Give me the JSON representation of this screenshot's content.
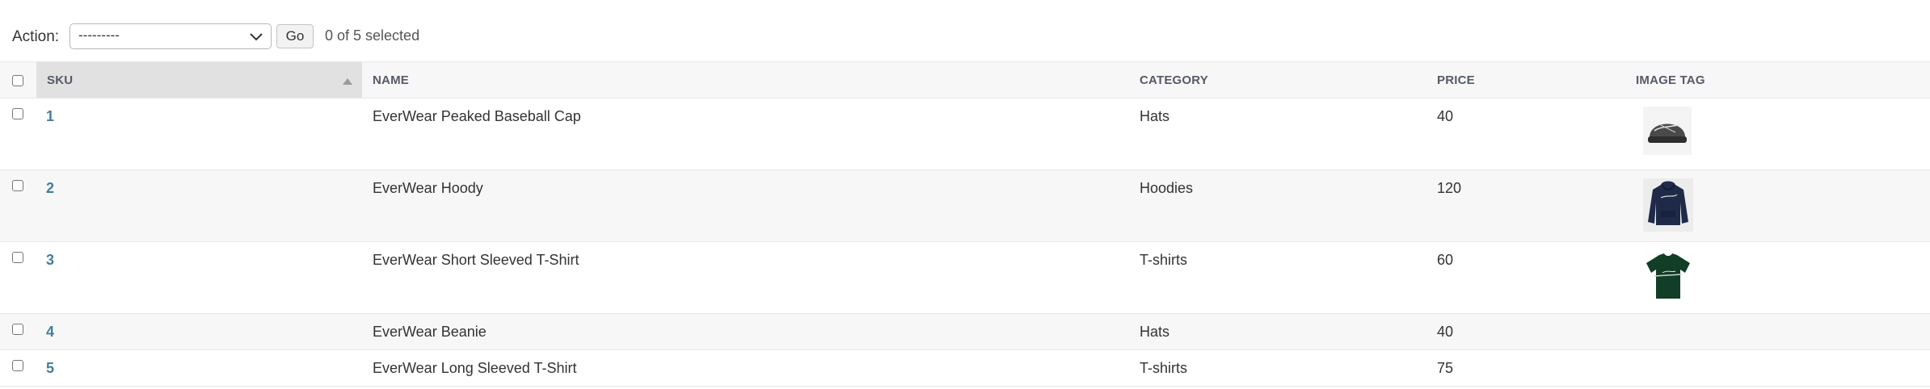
{
  "actions": {
    "label": "Action:",
    "select_value": "---------",
    "go_label": "Go",
    "selection_counter": "0 of 5 selected"
  },
  "table": {
    "headers": {
      "sku": "SKU",
      "name": "NAME",
      "category": "CATEGORY",
      "price": "PRICE",
      "image_tag": "IMAGE TAG"
    },
    "sorted_column": "sku",
    "sort_direction": "ascending",
    "rows": [
      {
        "sku": "1",
        "name": "EverWear Peaked Baseball Cap",
        "category": "Hats",
        "price": "40",
        "image": "baseball-cap-thumbnail"
      },
      {
        "sku": "2",
        "name": "EverWear Hoody",
        "category": "Hoodies",
        "price": "120",
        "image": "hoodie-thumbnail"
      },
      {
        "sku": "3",
        "name": "EverWear Short Sleeved T-Shirt",
        "category": "T-shirts",
        "price": "60",
        "image": "tshirt-thumbnail"
      },
      {
        "sku": "4",
        "name": "EverWear Beanie",
        "category": "Hats",
        "price": "40",
        "image": ""
      },
      {
        "sku": "5",
        "name": "EverWear Long Sleeved T-Shirt",
        "category": "T-shirts",
        "price": "75",
        "image": ""
      }
    ]
  },
  "colors": {
    "link": "#447e9b",
    "header_bg": "#f7f7f7",
    "sorted_header_bg": "#e1e1e1",
    "row_alt_bg": "#f7f7f7"
  }
}
